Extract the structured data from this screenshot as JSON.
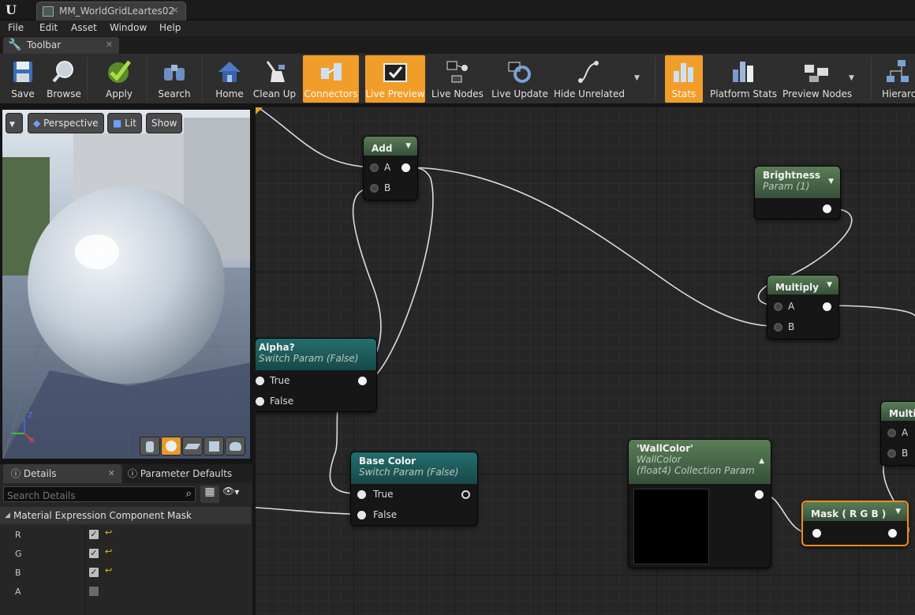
{
  "window": {
    "tab_title": "MM_WorldGridLeartes02"
  },
  "menu": [
    "File",
    "Edit",
    "Asset",
    "Window",
    "Help"
  ],
  "toolbar_tab": "Toolbar",
  "toolbar": {
    "buttons": [
      {
        "label": "Save",
        "icon": "save-icon",
        "active": false
      },
      {
        "label": "Browse",
        "icon": "magnifier-icon",
        "active": false
      },
      {
        "label": "Apply",
        "icon": "checkmark-icon",
        "active": false
      },
      {
        "label": "Search",
        "icon": "binoculars-icon",
        "active": false
      },
      {
        "label": "Home",
        "icon": "house-icon",
        "active": false
      },
      {
        "label": "Clean Up",
        "icon": "broom-icon",
        "active": false
      },
      {
        "label": "Connectors",
        "icon": "connectors-icon",
        "active": true
      },
      {
        "label": "Live Preview",
        "icon": "tv-check-icon",
        "active": true
      },
      {
        "label": "Live Nodes",
        "icon": "live-nodes-icon",
        "active": false
      },
      {
        "label": "Live Update",
        "icon": "live-update-icon",
        "active": false
      },
      {
        "label": "Hide Unrelated",
        "icon": "hide-unrelated-icon",
        "active": false
      },
      {
        "label": "Stats",
        "icon": "stats-icon",
        "active": true
      },
      {
        "label": "Platform Stats",
        "icon": "platform-stats-icon",
        "active": false
      },
      {
        "label": "Preview Nodes",
        "icon": "preview-nodes-icon",
        "active": false
      },
      {
        "label": "Hierarch",
        "icon": "hierarchy-icon",
        "active": false
      }
    ],
    "active_color": "#f19d2a"
  },
  "viewport": {
    "view_mode": "Perspective",
    "lighting": "Lit",
    "show": "Show",
    "axis": {
      "z": "Z",
      "x": "X"
    }
  },
  "details": {
    "tabs": [
      "Details",
      "Parameter Defaults"
    ],
    "search_placeholder": "Search Details",
    "category": "Material Expression Component Mask",
    "properties": [
      {
        "name": "R",
        "checked": true
      },
      {
        "name": "G",
        "checked": true
      },
      {
        "name": "B",
        "checked": true
      },
      {
        "name": "A",
        "checked": false
      }
    ]
  },
  "graph": {
    "nodes": {
      "add": {
        "title": "Add",
        "pins": [
          "A",
          "B"
        ]
      },
      "brightness": {
        "title": "Brightness",
        "subtitle": "Param (1)"
      },
      "multiply1": {
        "title": "Multiply",
        "pins": [
          "A",
          "B"
        ]
      },
      "alpha": {
        "title": "Alpha?",
        "subtitle": "Switch Param (False)",
        "pins": [
          "True",
          "False"
        ]
      },
      "basecolor": {
        "title": "Base Color",
        "subtitle": "Switch Param (False)",
        "pins": [
          "True",
          "False"
        ]
      },
      "wallcolor": {
        "title": "'WallColor'",
        "subtitle": "WallColor",
        "subtitle2": "(float4) Collection Param"
      },
      "mask": {
        "title": "Mask ( R G B )"
      },
      "multiply2": {
        "title": "Multip",
        "pins": [
          "A",
          "B"
        ]
      }
    }
  }
}
